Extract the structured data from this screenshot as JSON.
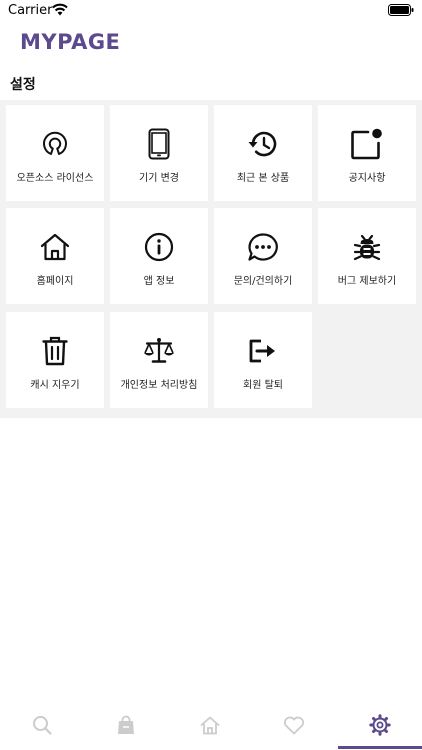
{
  "status_bar": {
    "carrier": "Carrier"
  },
  "header": {
    "title": "MYPAGE"
  },
  "section": {
    "title": "설정"
  },
  "tiles": [
    {
      "label": "오픈소스 라이선스",
      "icon": "open-source-icon"
    },
    {
      "label": "기기 변경",
      "icon": "phone-icon"
    },
    {
      "label": "최근 본 상품",
      "icon": "history-icon"
    },
    {
      "label": "공지사항",
      "icon": "notification-icon"
    },
    {
      "label": "홈페이지",
      "icon": "home-icon"
    },
    {
      "label": "앱 정보",
      "icon": "info-icon"
    },
    {
      "label": "문의/건의하기",
      "icon": "chat-icon"
    },
    {
      "label": "버그 제보하기",
      "icon": "bug-icon"
    },
    {
      "label": "캐시 지우기",
      "icon": "trash-icon"
    },
    {
      "label": "개인정보 처리방침",
      "icon": "scale-icon"
    },
    {
      "label": "회원 탈퇴",
      "icon": "logout-icon"
    }
  ],
  "tab_bar": {
    "tabs": [
      {
        "icon": "search-icon"
      },
      {
        "icon": "shopping-bag-icon"
      },
      {
        "icon": "home-icon"
      },
      {
        "icon": "heart-icon"
      },
      {
        "icon": "gear-icon"
      }
    ],
    "active_tab": 4,
    "accent_color": "#5b4a8c",
    "inactive_color": "#cccccc"
  }
}
